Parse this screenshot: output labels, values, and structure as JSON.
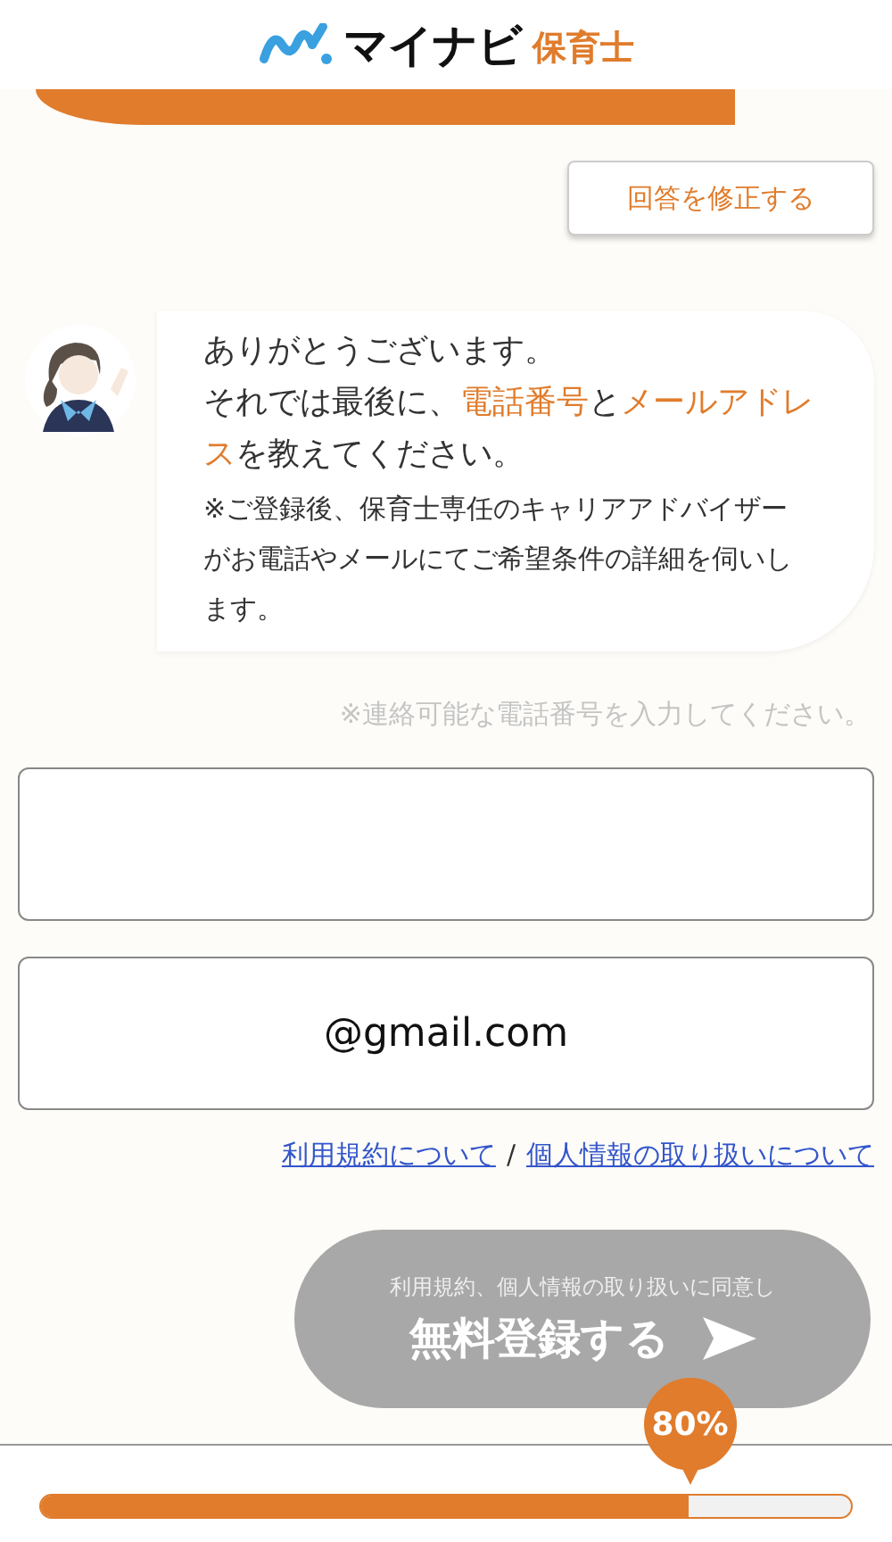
{
  "header": {
    "logo_main": "マイナビ",
    "logo_sub": "保育士"
  },
  "edit_button": "回答を修正する",
  "message": {
    "lines": [
      [
        {
          "text": "ありがとうございます。",
          "highlight": false
        }
      ],
      [
        {
          "text": "それでは最後に、",
          "highlight": false
        },
        {
          "text": "電話番号",
          "highlight": true
        },
        {
          "text": "と",
          "highlight": false
        },
        {
          "text": "メールアドレス",
          "highlight": true
        },
        {
          "text": "を教えてください。",
          "highlight": false
        }
      ]
    ],
    "note": "※ご登録後、保育士専任のキャリアアドバイザーがお電話やメールにてご希望条件の詳細を伺いします。"
  },
  "hint": "※連絡可能な電話番号を入力してください。",
  "fields": [
    {
      "kind": "phone"
    },
    {
      "kind": "email",
      "value": "@gmail.com"
    }
  ],
  "links": [
    {
      "label": "利用規約について"
    },
    {
      "label": "個人情報の取り扱いについて"
    }
  ],
  "link_separator": "/",
  "submit": {
    "caption": "利用規約、個人情報の取り扱いに同意し",
    "label": "無料登録する",
    "disabled": true
  },
  "progress": {
    "reading": "80%",
    "level": 0.8
  }
}
